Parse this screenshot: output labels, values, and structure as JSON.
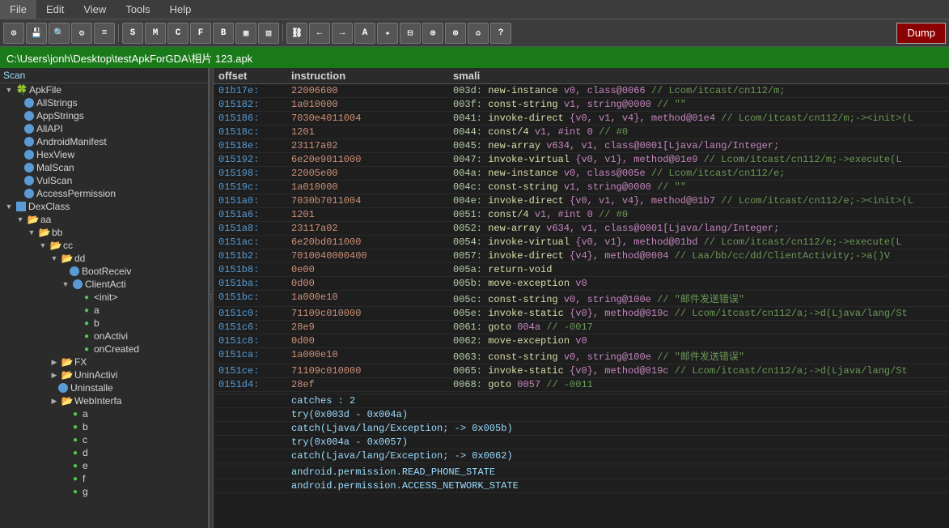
{
  "menubar": {
    "items": [
      "File",
      "Edit",
      "View",
      "Tools",
      "Help"
    ]
  },
  "toolbar": {
    "buttons": [
      {
        "label": "⊙",
        "name": "btn1"
      },
      {
        "label": "💾",
        "name": "btn2"
      },
      {
        "label": "🔍",
        "name": "btn3"
      },
      {
        "label": "⚙",
        "name": "btn4"
      },
      {
        "label": "≡",
        "name": "btn5"
      },
      {
        "label": "S",
        "name": "btnS"
      },
      {
        "label": "M",
        "name": "btnM"
      },
      {
        "label": "C",
        "name": "btnC"
      },
      {
        "label": "F",
        "name": "btnF"
      },
      {
        "label": "B",
        "name": "btnB"
      },
      {
        "label": "▦",
        "name": "btn6"
      },
      {
        "label": "▧",
        "name": "btn7"
      },
      {
        "label": "⛓",
        "name": "btn8"
      },
      {
        "label": "⇤",
        "name": "btn9"
      },
      {
        "label": "⇥",
        "name": "btn10"
      },
      {
        "label": "A",
        "name": "btnA"
      },
      {
        "label": "✦",
        "name": "btn11"
      },
      {
        "label": "⊟",
        "name": "btn12"
      },
      {
        "label": "⊕",
        "name": "btn13"
      },
      {
        "label": "⊗",
        "name": "btn14"
      },
      {
        "label": "♻",
        "name": "btn15"
      },
      {
        "label": "?",
        "name": "btnHelp"
      }
    ],
    "dump_label": "Dump"
  },
  "pathbar": {
    "path": "C:\\Users\\jonh\\Desktop\\testApkForGDA\\相片 123.apk"
  },
  "sidebar": {
    "scan_label": "Scan",
    "tree": [
      {
        "indent": 0,
        "icon": "expand",
        "type": "apk",
        "label": "ApkFile",
        "expanded": true
      },
      {
        "indent": 1,
        "icon": "circle-blue",
        "type": "item",
        "label": "AllStrings"
      },
      {
        "indent": 1,
        "icon": "circle-blue",
        "type": "item",
        "label": "AppStrings"
      },
      {
        "indent": 1,
        "icon": "circle-blue",
        "type": "item",
        "label": "AllAPI"
      },
      {
        "indent": 1,
        "icon": "circle-blue",
        "type": "item",
        "label": "AndroidManifest"
      },
      {
        "indent": 1,
        "icon": "circle-blue",
        "type": "item",
        "label": "HexView"
      },
      {
        "indent": 1,
        "icon": "circle-blue",
        "type": "item",
        "label": "MalScan"
      },
      {
        "indent": 1,
        "icon": "circle-blue",
        "type": "item",
        "label": "VulScan"
      },
      {
        "indent": 1,
        "icon": "circle-blue",
        "type": "item",
        "label": "AccessPermission"
      },
      {
        "indent": 0,
        "icon": "expand",
        "type": "dex",
        "label": "DexClass",
        "expanded": true
      },
      {
        "indent": 1,
        "icon": "expand",
        "type": "folder",
        "label": "aa",
        "expanded": true
      },
      {
        "indent": 2,
        "icon": "expand",
        "type": "folder",
        "label": "bb",
        "expanded": true
      },
      {
        "indent": 3,
        "icon": "expand",
        "type": "folder",
        "label": "cc",
        "expanded": true
      },
      {
        "indent": 4,
        "icon": "expand",
        "type": "folder",
        "label": "dd",
        "expanded": true
      },
      {
        "indent": 5,
        "icon": "circle-blue",
        "type": "item",
        "label": "BootReceiv"
      },
      {
        "indent": 5,
        "icon": "expand",
        "type": "class",
        "label": "ClientActi",
        "expanded": true
      },
      {
        "indent": 6,
        "icon": "circle-green",
        "type": "method",
        "label": "<init>"
      },
      {
        "indent": 6,
        "icon": "circle-green",
        "type": "method",
        "label": "a"
      },
      {
        "indent": 6,
        "icon": "circle-green",
        "type": "method",
        "label": "b"
      },
      {
        "indent": 6,
        "icon": "circle-green",
        "type": "method",
        "label": "onActivi"
      },
      {
        "indent": 6,
        "icon": "circle-green",
        "type": "method",
        "label": "onCreated"
      },
      {
        "indent": 4,
        "icon": "expand",
        "type": "folder",
        "label": "FX",
        "expanded": false
      },
      {
        "indent": 4,
        "icon": "expand",
        "type": "folder",
        "label": "UninActivi",
        "expanded": false
      },
      {
        "indent": 4,
        "icon": "circle-blue",
        "type": "item",
        "label": "Uninstalle"
      },
      {
        "indent": 4,
        "icon": "expand",
        "type": "folder",
        "label": "WebInterfa",
        "expanded": false
      },
      {
        "indent": 5,
        "icon": "circle-green",
        "type": "method",
        "label": "a"
      },
      {
        "indent": 5,
        "icon": "circle-green",
        "type": "method",
        "label": "b"
      },
      {
        "indent": 5,
        "icon": "circle-green",
        "type": "method",
        "label": "c"
      },
      {
        "indent": 5,
        "icon": "circle-green",
        "type": "method",
        "label": "d"
      },
      {
        "indent": 5,
        "icon": "circle-green",
        "type": "method",
        "label": "e"
      },
      {
        "indent": 5,
        "icon": "circle-green",
        "type": "method",
        "label": "f"
      },
      {
        "indent": 5,
        "icon": "circle-green",
        "type": "method",
        "label": "g"
      }
    ]
  },
  "codetable": {
    "headers": {
      "offset": "offset",
      "instruction": "instruction",
      "smali": "smali"
    },
    "rows": [
      {
        "offset": "01b17e:",
        "instruction": "22006600",
        "smali": "003d: new-instance v0, class@0066 // Lcom/itcast/cn112/m;"
      },
      {
        "offset": "015182:",
        "instruction": "1a010000",
        "smali": "003f: const-string v1, string@0000 // \"\""
      },
      {
        "offset": "015186:",
        "instruction": "7030e4011004",
        "smali": "0041: invoke-direct {v0, v1, v4}, method@01e4 // Lcom/itcast/cn112/m;-><init>(L"
      },
      {
        "offset": "01518c:",
        "instruction": "1201",
        "smali": "0044: const/4 v1, #int 0 // #0"
      },
      {
        "offset": "01518e:",
        "instruction": "23117a02",
        "smali": "0045: new-array v634, v1, class@0001[Ljava/lang/Integer;"
      },
      {
        "offset": "015192:",
        "instruction": "6e20e9011000",
        "smali": "0047: invoke-virtual {v0, v1}, method@01e9 // Lcom/itcast/cn112/m;->execute(L"
      },
      {
        "offset": "015198:",
        "instruction": "22005e00",
        "smali": "004a: new-instance v0, class@005e // Lcom/itcast/cn112/e;"
      },
      {
        "offset": "01519c:",
        "instruction": "1a010000",
        "smali": "004c: const-string v1, string@0000 // \"\""
      },
      {
        "offset": "0151a0:",
        "instruction": "7030b7011004",
        "smali": "004e: invoke-direct {v0, v1, v4}, method@01b7 // Lcom/itcast/cn112/e;-><init>(L"
      },
      {
        "offset": "0151a6:",
        "instruction": "1201",
        "smali": "0051: const/4 v1, #int 0 // #0"
      },
      {
        "offset": "0151a8:",
        "instruction": "23117a02",
        "smali": "0052: new-array v634, v1, class@0001[Ljava/lang/Integer;"
      },
      {
        "offset": "0151ac:",
        "instruction": "6e20bd011000",
        "smali": "0054: invoke-virtual {v0, v1}, method@01bd // Lcom/itcast/cn112/e;->execute(L"
      },
      {
        "offset": "0151b2:",
        "instruction": "7010040000400",
        "smali": "0057: invoke-direct {v4}, method@0004 // Laa/bb/cc/dd/ClientActivity;->a()V"
      },
      {
        "offset": "0151b8:",
        "instruction": "0e00",
        "smali": "005a: return-void"
      },
      {
        "offset": "0151ba:",
        "instruction": "0d00",
        "smali": "005b: move-exception v0"
      },
      {
        "offset": "0151bc:",
        "instruction": "1a000e10",
        "smali": "005c: const-string v0, string@100e // \"邮件发送错误\""
      },
      {
        "offset": "0151c0:",
        "instruction": "71109c010000",
        "smali": "005e: invoke-static {v0}, method@019c // Lcom/itcast/cn112/a;->d(Ljava/lang/St"
      },
      {
        "offset": "0151c6:",
        "instruction": "28e9",
        "smali": "0061: goto 004a // -0017"
      },
      {
        "offset": "0151c8:",
        "instruction": "0d00",
        "smali": "0062: move-exception v0"
      },
      {
        "offset": "0151ca:",
        "instruction": "1a000e10",
        "smali": "0063: const-string v0, string@100e // \"邮件发送错误\""
      },
      {
        "offset": "0151ce:",
        "instruction": "71109c010000",
        "smali": "0065: invoke-static {v0}, method@019c // Lcom/itcast/cn112/a;->d(Ljava/lang/St"
      },
      {
        "offset": "0151d4:",
        "instruction": "28ef",
        "smali": "0068: goto 0057 // -0011"
      },
      {
        "offset": "",
        "instruction": "",
        "smali": ""
      },
      {
        "offset": "",
        "instruction": "    catches    : 2",
        "smali": ""
      },
      {
        "offset": "",
        "instruction": "    try(0x003d - 0x004a)",
        "smali": ""
      },
      {
        "offset": "",
        "instruction": "    catch(Ljava/lang/Exception; -> 0x005b)",
        "smali": ""
      },
      {
        "offset": "",
        "instruction": "    try(0x004a - 0x0057)",
        "smali": ""
      },
      {
        "offset": "",
        "instruction": "    catch(Ljava/lang/Exception; -> 0x0062)",
        "smali": ""
      },
      {
        "offset": "",
        "instruction": "",
        "smali": ""
      },
      {
        "offset": "",
        "instruction": "android.permission.READ_PHONE_STATE",
        "smali": ""
      },
      {
        "offset": "",
        "instruction": "android.permission.ACCESS_NETWORK_STATE",
        "smali": ""
      }
    ]
  }
}
